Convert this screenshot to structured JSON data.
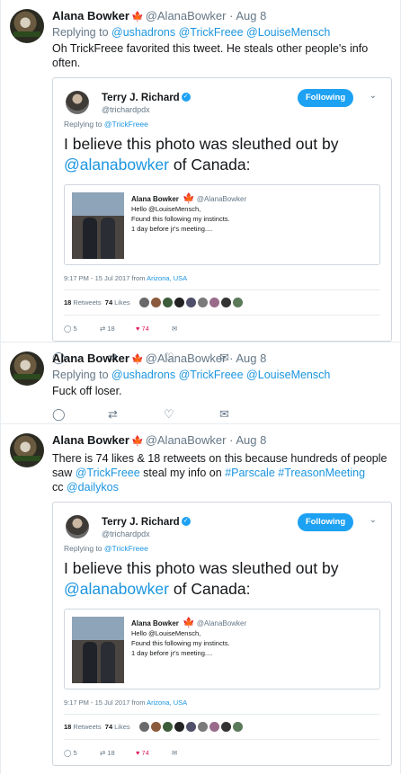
{
  "tweets": [
    {
      "name": "Alana Bowker",
      "handle": "@AlanaBowker",
      "time": "Aug 8",
      "text": "Oh TrickFreee favorited this tweet. He steals other people's info often.",
      "embed": {
        "name": "Terry J. Richard",
        "handle": "@trichardpdx",
        "follow_label": "Following",
        "reply_label": "Replying to",
        "reply_to": "@TrickFreee",
        "big_text_1": "I believe this photo was sleuthed out by",
        "big_mention": "@alanabowker",
        "big_text_2": " of Canada:",
        "quote_name": "Alana Bowker",
        "quote_handle": "@AlanaBowker",
        "quote_line1": "Hello @LouiseMensch,",
        "quote_line2": "Found this following my instincts.",
        "quote_line3": "1 day before jr's meeting....",
        "meta": "9:17 PM - 15 Jul 2017 from",
        "meta_place": "Arizona, USA",
        "retweets": "18",
        "retweets_label": "Retweets",
        "likes": "74",
        "likes_label": "Likes",
        "reply_count": "5",
        "retweet_count": "18",
        "like_count": "74"
      }
    },
    {
      "name": "Alana Bowker",
      "handle": "@AlanaBowker",
      "time": "Aug 8",
      "reply_label": "Replying to",
      "reply_to": [
        "@ushadrons",
        "@TrickFreee",
        "@LouiseMensch"
      ],
      "text": "Fuck off loser."
    },
    {
      "name": "Alana Bowker",
      "handle": "@AlanaBowker",
      "time": "Aug 8",
      "text_1": "There is 74 likes & 18 retweets on this because hundreds of people saw",
      "text_link": "@TrickFreee",
      "text_2": " steal my info on ",
      "text_tag1": "#Parscale",
      "text_tag2": "#TreasonMeeting",
      "text_cc": "cc ",
      "text_cc_link": "@dailykos",
      "embed": {
        "name": "Terry J. Richard",
        "handle": "@trichardpdx",
        "follow_label": "Following",
        "reply_label": "Replying to",
        "reply_to": "@TrickFreee",
        "big_text_1": "I believe this photo was sleuthed out by",
        "big_mention": "@alanabowker",
        "big_text_2": " of Canada:",
        "quote_name": "Alana Bowker",
        "quote_handle": "@AlanaBowker",
        "quote_line1": "Hello @LouiseMensch,",
        "quote_line2": "Found this following my instincts.",
        "quote_line3": "1 day before jr's meeting....",
        "meta": "9:17 PM - 15 Jul 2017 from",
        "meta_place": "Arizona, USA",
        "retweets": "18",
        "retweets_label": "Retweets",
        "likes": "74",
        "likes_label": "Likes",
        "reply_count": "5",
        "retweet_count": "18",
        "like_count": "74"
      }
    }
  ],
  "reply_to_first": [
    "@ushadrons",
    "@TrickFreee",
    "@LouiseMensch"
  ],
  "reply_label": "Replying to",
  "dot": "·",
  "icons": {
    "reply": "reply-icon",
    "retweet": "retweet-icon",
    "like": "heart-icon",
    "dm": "envelope-icon",
    "leaf": "maple-leaf-icon"
  },
  "colors": {
    "link": "#1b95e0",
    "follow": "#1da1f2",
    "leaf": "#d9262c"
  }
}
